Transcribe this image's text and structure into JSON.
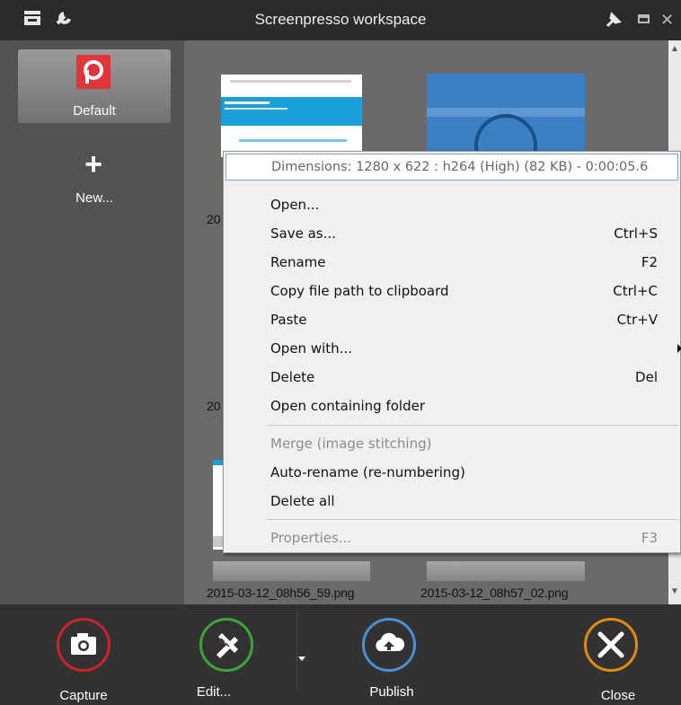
{
  "window": {
    "title": "Screenpresso workspace",
    "icons": [
      "inbox-icon",
      "wrench-icon",
      "pin-icon",
      "maximize-icon",
      "close-icon"
    ]
  },
  "sidebar": {
    "workspaces": [
      {
        "label": "Default",
        "selected": true,
        "icon": "screenpresso-logo-icon"
      },
      {
        "label": "New...",
        "icon": "plus-icon"
      }
    ]
  },
  "workspace": {
    "partial_labels": [
      "20",
      "20"
    ],
    "files": [
      {
        "filename": "2015-03-12_08h56_59.png"
      },
      {
        "filename": "2015-03-12_08h57_02.png"
      }
    ]
  },
  "context_menu": {
    "header": "Dimensions: 1280 x 622 : h264 (High) (82 KB) - 0:00:05.6",
    "groups": [
      [
        {
          "label": "Open...",
          "shortcut": ""
        },
        {
          "label": "Save as...",
          "shortcut": "Ctrl+S"
        },
        {
          "label": "Rename",
          "shortcut": "F2"
        },
        {
          "label": "Copy file path to clipboard",
          "shortcut": "Ctrl+C"
        },
        {
          "label": "Paste",
          "shortcut": "Ctr+V"
        },
        {
          "label": "Open with...",
          "shortcut": "",
          "submenu": true
        },
        {
          "label": "Delete",
          "shortcut": "Del"
        },
        {
          "label": "Open containing folder",
          "shortcut": ""
        }
      ],
      [
        {
          "label": "Merge (image stitching)",
          "shortcut": "",
          "disabled": true
        },
        {
          "label": "Auto-rename (re-numbering)",
          "shortcut": ""
        },
        {
          "label": "Delete all",
          "shortcut": ""
        }
      ],
      [
        {
          "label": "Properties...",
          "shortcut": "F3",
          "disabled": true
        }
      ]
    ]
  },
  "toolbar": {
    "capture_label": "Capture",
    "edit_label": "Edit...",
    "publish_label": "Publish",
    "close_label": "Close"
  },
  "colors": {
    "capture": "#d0222a",
    "edit": "#3fa33b",
    "publish": "#4a8fd5",
    "close": "#e08a16",
    "logo": "#e0353a"
  }
}
